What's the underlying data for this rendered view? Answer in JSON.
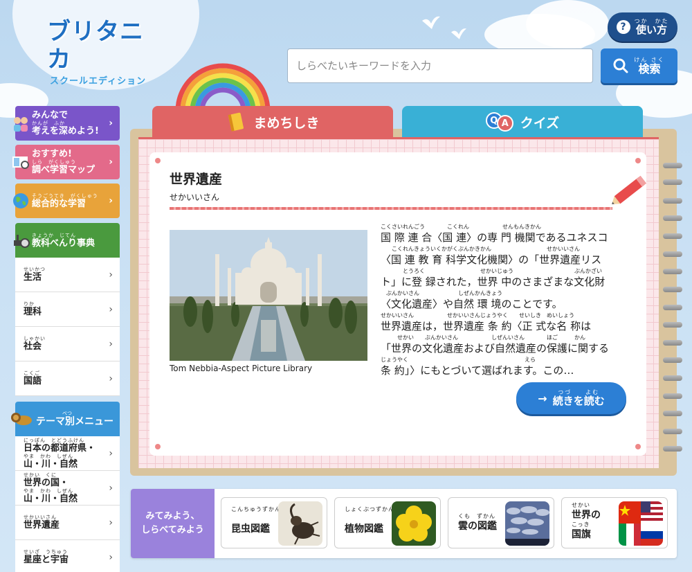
{
  "logo": {
    "main": "ブリタニカ",
    "sub": "スクールエディション"
  },
  "header": {
    "howto": {
      "ruby": "つか　かた",
      "label": "使い方"
    },
    "search": {
      "placeholder": "しらべたいキーワードを入力",
      "button_ruby": "けん さく",
      "button_label": "検索"
    }
  },
  "sidebar": {
    "cards": [
      {
        "ruby": "",
        "line1": "みんなで",
        "ruby2": "かんが　ふか",
        "line2": "考えを深めよう!",
        "color": "#7a55c9"
      },
      {
        "ruby": "",
        "line1": "おすすめ!",
        "ruby2": "しら　がくしゅう",
        "line2": "調べ学習マップ",
        "color": "#e36a8a"
      },
      {
        "ruby": "そうごうてき　がくしゅう",
        "line1": "総合的な学習",
        "color": "#e8a33a"
      },
      {
        "ruby": "きょうか　じてん",
        "line1": "教科べんり事典",
        "color": "#4a9a3e"
      }
    ],
    "subjects": [
      {
        "ruby": "せいかつ",
        "label": "生活"
      },
      {
        "ruby": "りか",
        "label": "理科"
      },
      {
        "ruby": "しゃかい",
        "label": "社会"
      },
      {
        "ruby": "こくご",
        "label": "国語"
      }
    ],
    "theme_header": {
      "ruby": "べつ",
      "label": "テーマ別メニュー"
    },
    "themes": [
      {
        "ruby": "にっぽん　とどうふけん",
        "label": "日本の都道府県・",
        "ruby2": "やま　かわ　しぜん",
        "label2": "山・川・自然"
      },
      {
        "ruby": "せかい　くに",
        "label": "世界の国・",
        "ruby2": "やま　かわ　しぜん",
        "label2": "山・川・自然"
      },
      {
        "ruby": "せかいいさん",
        "label": "世界遺産"
      },
      {
        "ruby": "せいざ　うちゅう",
        "label": "星座と宇宙"
      }
    ]
  },
  "tabs": {
    "trivia": "まめちしき",
    "quiz": "クイズ",
    "quiz_badge_q": "Q",
    "quiz_badge_a": "A"
  },
  "article": {
    "title": "世界遺産",
    "kana": "せかいいさん",
    "credit": "Tom Nebbia-Aspect Picture Library",
    "lines": [
      {
        "ruby": "こくさいれんごう　　　　こくれん　　　　　　せんもんきかん",
        "text": "国 際 連 合〈国 連〉の専 門 機関であるユネスコ"
      },
      {
        "ruby": "　　こくれんきょういくかがくぶんかきかん　　　　　　　　　　せかいいさん",
        "text": "〈国 連 教 育 科学文化機関〉の「世界遺産リス"
      },
      {
        "ruby": "　　　　とうろく　　　　　　　　　　せかいじゅう　　　　　　　　　　　ぶんかざい",
        "text": "ト」に登 録された，世界 中のさまざまな文化財"
      },
      {
        "ruby": "　ぶんかいさん　　　　　　　しぜんかんきょう",
        "text": "〈文化遺産〉や自然 環 境のことです。"
      },
      {
        "ruby": "せかいいさん　　　　　　せかいいさんじょうやく　　せいしき　めいしょう",
        "text": "世界遺産は，世界遺産 条 約〈正 式な名 称は"
      },
      {
        "ruby": "　　　せかい　　ぶんかいさん　　　　　　しぜんいさん　　　　ほご　　　かん",
        "text": "「世界の文化遺産および自然遺産の保護に関する"
      },
      {
        "ruby": "じょうやく　　　　　　　　　　　　　　　　　　　　　えら",
        "text": "条 約」〉にもとづいて選ばれます。この…"
      }
    ],
    "read_more_ruby": "つづ　　よむ",
    "read_more_label": "続きを読む"
  },
  "bottom": {
    "header_line1": "みてみよう、",
    "header_line2": "しらべてみよう",
    "tiles": [
      {
        "ruby": "こんちゅうずかん",
        "label": "昆虫図鑑",
        "ruby2": ""
      },
      {
        "ruby": "しょくぶつずかん",
        "label": "植物図鑑",
        "ruby2": ""
      },
      {
        "ruby": "くも　ずかん",
        "label": "雲の図鑑",
        "ruby2": ""
      },
      {
        "ruby": "せかい",
        "label": "世界の",
        "ruby2": "こっき",
        "label2": "国旗"
      }
    ]
  },
  "colors": {
    "accent_blue": "#2c7fd5",
    "navy": "#1f4f8c",
    "tab_red": "#e06464",
    "tab_teal": "#39b0d6"
  }
}
